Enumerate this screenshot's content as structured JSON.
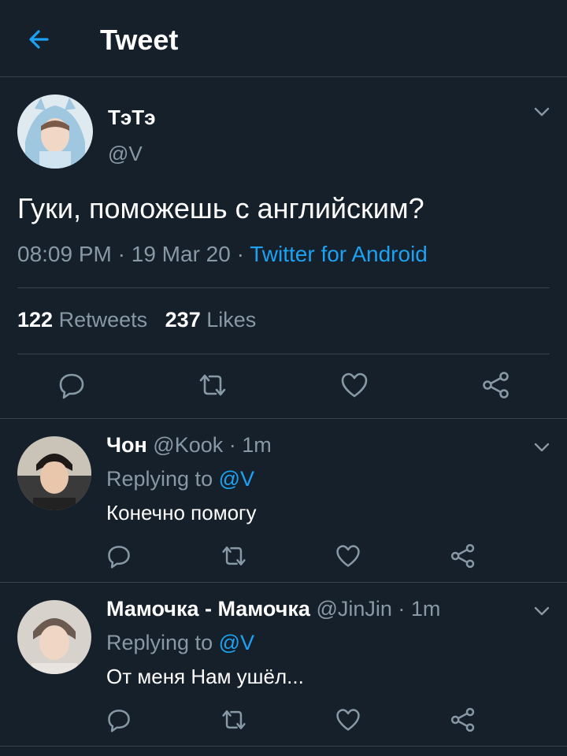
{
  "header": {
    "title": "Tweet",
    "back_icon": "arrow-left-icon"
  },
  "colors": {
    "background": "#15202b",
    "accent": "#1da1f2",
    "muted": "#8899a6",
    "divider": "#38444d"
  },
  "tweet": {
    "name": "ТэТэ",
    "handle": "@V",
    "text": "Гуки, поможешь с английским?",
    "time": "08:09 PM",
    "sep1": " · ",
    "date": "19 Mar 20",
    "sep2": " · ",
    "source": "Twitter for Android",
    "retweets_count": "122",
    "retweets_label": "Retweets",
    "likes_count": "237",
    "likes_label": "Likes"
  },
  "replies": [
    {
      "name": "Чон",
      "handle": "@Kook",
      "time": " · 1m",
      "replying_prefix": "Replying to ",
      "replying_to": "@V",
      "text": "Конечно помогу"
    },
    {
      "name": "Мамочка - Мамочка",
      "handle": "@JinJin",
      "time": " · 1m",
      "replying_prefix": "Replying to ",
      "replying_to": "@V",
      "text": "От меня Нам ушёл..."
    }
  ]
}
